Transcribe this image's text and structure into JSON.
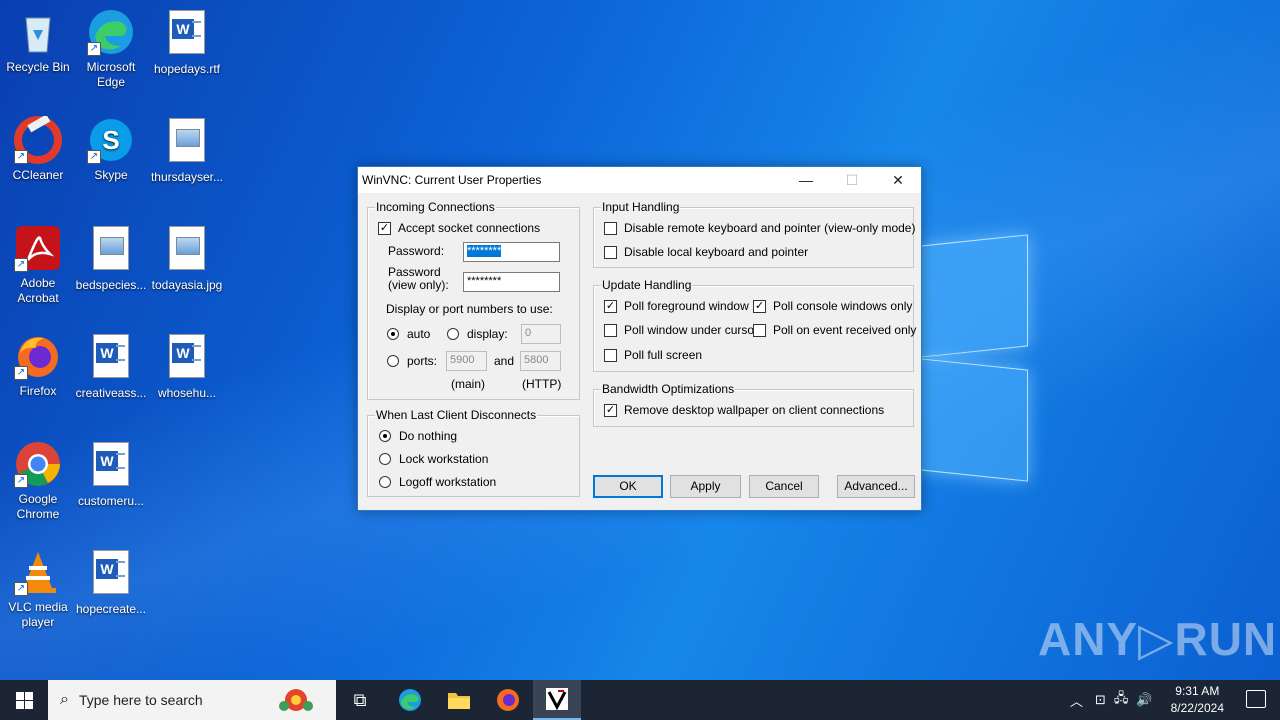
{
  "desktop": {
    "icons": [
      {
        "label": "Recycle Bin",
        "icon": "recycle-bin-icon"
      },
      {
        "label": "Microsoft Edge",
        "icon": "edge-icon"
      },
      {
        "label": "hopedays.rtf",
        "icon": "word-doc-icon"
      },
      {
        "label": "CCleaner",
        "icon": "ccleaner-icon"
      },
      {
        "label": "Skype",
        "icon": "skype-icon"
      },
      {
        "label": "thursdayser...",
        "icon": "image-file-icon"
      },
      {
        "label": "Adobe Acrobat",
        "icon": "acrobat-icon"
      },
      {
        "label": "bedspecies...",
        "icon": "image-file-icon"
      },
      {
        "label": "todayasia.jpg",
        "icon": "image-file-icon"
      },
      {
        "label": "Firefox",
        "icon": "firefox-icon"
      },
      {
        "label": "creativeass...",
        "icon": "word-doc-icon"
      },
      {
        "label": "whosehu...",
        "icon": "word-doc-icon"
      },
      {
        "label": "Google Chrome",
        "icon": "chrome-icon"
      },
      {
        "label": "customeru...",
        "icon": "word-doc-icon"
      },
      {
        "label": "VLC media player",
        "icon": "vlc-icon"
      },
      {
        "label": "hopecreate...",
        "icon": "word-doc-icon"
      }
    ]
  },
  "dialog": {
    "title": "WinVNC: Current User Properties",
    "incoming": {
      "label": "Incoming Connections",
      "accept_label": "Accept socket connections",
      "accept_checked": true,
      "password_label": "Password:",
      "password_value": "********",
      "password_view_label1": "Password",
      "password_view_label2": "(view only):",
      "password_view_value": "********",
      "display_label": "Display or port numbers to use:",
      "auto_label": "auto",
      "display_radio_label": "display:",
      "display_value": "0",
      "ports_label": "ports:",
      "port_main": "5900",
      "and_label": "and",
      "port_http": "5800",
      "main_label": "(main)",
      "http_label": "(HTTP)"
    },
    "disconnect": {
      "label": "When Last Client Disconnects",
      "options": [
        "Do nothing",
        "Lock workstation",
        "Logoff workstation"
      ],
      "selected": "Do nothing"
    },
    "input": {
      "label": "Input Handling",
      "opt1": "Disable remote keyboard and pointer (view-only mode)",
      "opt2": "Disable local keyboard and pointer"
    },
    "update": {
      "label": "Update Handling",
      "poll_foreground": "Poll foreground window",
      "poll_console": "Poll console windows only",
      "poll_cursor": "Poll window under cursor",
      "poll_event": "Poll on event received only",
      "poll_full": "Poll full screen"
    },
    "bandwidth": {
      "label": "Bandwidth Optimizations",
      "remove_wallpaper": "Remove desktop wallpaper on client connections"
    },
    "buttons": {
      "ok": "OK",
      "apply": "Apply",
      "cancel": "Cancel",
      "advanced": "Advanced..."
    }
  },
  "taskbar": {
    "search_placeholder": "Type here to search",
    "time": "9:31 AM",
    "date": "8/22/2024"
  },
  "watermark": "ANY▷RUN",
  "colors": {
    "accent": "#0078d7",
    "taskbar": "#1c2533",
    "desktop": "#0c63d6"
  }
}
